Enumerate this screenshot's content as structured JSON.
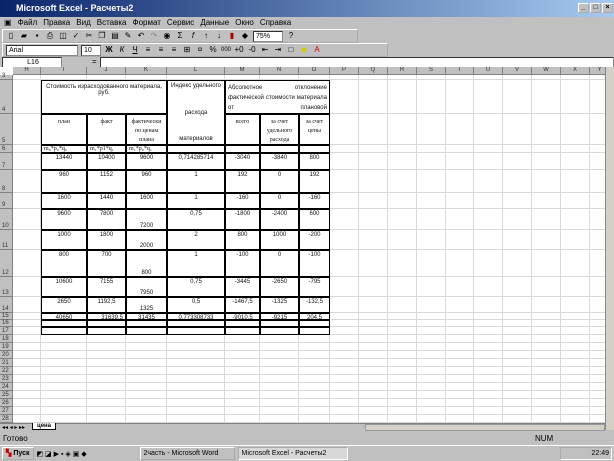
{
  "window": {
    "title": "Microsoft Excel - Расчеты2"
  },
  "menu": [
    "Файл",
    "Правка",
    "Вид",
    "Вставка",
    "Формат",
    "Сервис",
    "Данные",
    "Окно",
    "Справка"
  ],
  "toolbar": {
    "zoom": "75%",
    "font": "Arial",
    "size": "10",
    "bold": "Ж",
    "italic": "К",
    "underline": "Ч",
    "percent": "%",
    "thousands": "000"
  },
  "formula_bar": {
    "name_box": "L16",
    "equals": "=",
    "value": ""
  },
  "columns": [
    "H",
    "I",
    "J",
    "K",
    "L",
    "M",
    "N",
    "O",
    "P",
    "Q",
    "R",
    "S",
    "T",
    "U",
    "V",
    "W",
    "X",
    "Y"
  ],
  "rows": [
    "3",
    "4",
    "5",
    "6",
    "7",
    "8",
    "9",
    "10",
    "11",
    "12",
    "13",
    "14",
    "15",
    "16",
    "17",
    "18",
    "19",
    "20",
    "21",
    "22",
    "23",
    "24",
    "25",
    "26",
    "27",
    "28"
  ],
  "table": {
    "header_cost": "Стоимость израсходованного материала, руб.",
    "header_index": [
      "Индекс удельного",
      "расхода",
      "материалов"
    ],
    "header_dev": "Абсолютное отклонение фактической стоимости материала от плановой",
    "sub": [
      "план",
      "факт",
      "фактически по ценам плана",
      "всего",
      "за счет удельного расхода",
      "за счет цены"
    ],
    "formulas": [
      "m₀*p₀*q₀",
      "m₁*p1*q₁",
      "m₁*p₀*q₁"
    ],
    "data": [
      [
        "13440",
        "10400",
        "9600",
        "0,714285714",
        "-3040",
        "-3840",
        "800"
      ],
      [
        "960",
        "1152",
        "960",
        "1",
        "192",
        "0",
        "192"
      ],
      [
        "1600",
        "1440",
        "1600",
        "1",
        "-160",
        "0",
        "-160"
      ],
      [
        "9600",
        "7800",
        "7200",
        "0,75",
        "-1800",
        "-2400",
        "600"
      ],
      [
        "1000",
        "1800",
        "2000",
        "2",
        "800",
        "1000",
        "-200"
      ],
      [
        "800",
        "700",
        "800",
        "1",
        "-100",
        "0",
        "-100"
      ],
      [
        "10600",
        "7155",
        "7950",
        "0,75",
        "-3445",
        "-2650",
        "-795"
      ],
      [
        "2650",
        "1192,5",
        "1325",
        "0,5",
        "-1467,5",
        "-1325",
        "-132,5"
      ],
      [
        "40650",
        "31639,5",
        "31435",
        "0,773308733",
        "-9010,5",
        "-9215",
        "204,5"
      ]
    ]
  },
  "sheet_tab": "цена",
  "status": {
    "ready": "Готово",
    "num": "NUM"
  },
  "taskbar": {
    "start": "Пуск",
    "tasks": [
      "2часть - Microsoft Word",
      "Microsoft Excel - Расчеты2"
    ],
    "clock": "22:49"
  }
}
